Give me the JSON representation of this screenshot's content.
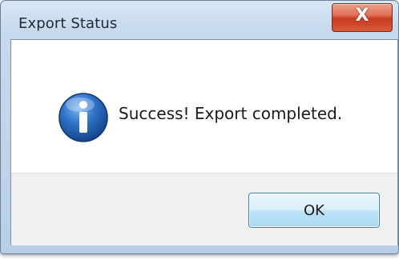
{
  "window": {
    "title": "Export Status",
    "close_glyph": "X"
  },
  "dialog": {
    "icon": "information-icon",
    "message": "Success! Export completed.",
    "ok_label": "OK"
  },
  "colors": {
    "title_bar": "#c6d9ee",
    "close_button": "#c93a1f",
    "info_icon": "#1f5fb3",
    "ok_button": "#bee3f8"
  }
}
